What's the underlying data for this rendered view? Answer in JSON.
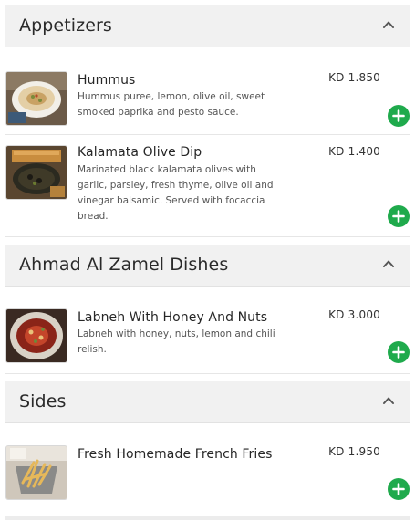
{
  "sections": [
    {
      "title": "Appetizers",
      "items": [
        {
          "name": "Hummus",
          "description": "Hummus puree, lemon, olive oil, sweet smoked paprika and pesto sauce.",
          "price": "KD 1.850",
          "image_icon": "hummus-bowl-image"
        },
        {
          "name": "Kalamata Olive Dip",
          "description": "Marinated black kalamata olives with garlic, parsley, fresh thyme, olive oil and vinegar balsamic. Served with focaccia bread.",
          "price": "KD 1.400",
          "image_icon": "olive-dip-image"
        }
      ]
    },
    {
      "title": "Ahmad Al Zamel Dishes",
      "items": [
        {
          "name": "Labneh With Honey And Nuts",
          "description": "Labneh with honey, nuts, lemon and chili relish.",
          "price": "KD 3.000",
          "image_icon": "labneh-plate-image"
        }
      ]
    },
    {
      "title": "Sides",
      "items": [
        {
          "name": "Fresh Homemade French Fries",
          "description": "",
          "price": "KD 1.950",
          "image_icon": "french-fries-image"
        }
      ]
    }
  ],
  "colors": {
    "add_button": "#1faa4c",
    "header_bg": "#f1f1f1"
  }
}
